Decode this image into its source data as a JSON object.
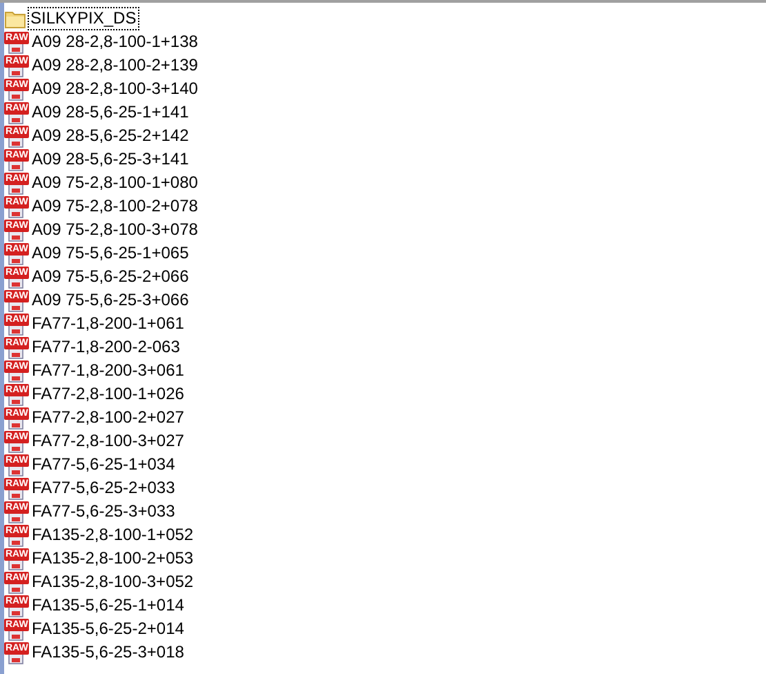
{
  "files": [
    {
      "kind": "folder",
      "name": "SILKYPIX_DS",
      "selected": true
    },
    {
      "kind": "raw",
      "badge": "RAW",
      "name": "A09 28-2,8-100-1+138",
      "selected": false
    },
    {
      "kind": "raw",
      "badge": "RAW",
      "name": "A09 28-2,8-100-2+139",
      "selected": false
    },
    {
      "kind": "raw",
      "badge": "RAW",
      "name": "A09 28-2,8-100-3+140",
      "selected": false
    },
    {
      "kind": "raw",
      "badge": "RAW",
      "name": "A09 28-5,6-25-1+141",
      "selected": false
    },
    {
      "kind": "raw",
      "badge": "RAW",
      "name": "A09 28-5,6-25-2+142",
      "selected": false
    },
    {
      "kind": "raw",
      "badge": "RAW",
      "name": "A09 28-5,6-25-3+141",
      "selected": false
    },
    {
      "kind": "raw",
      "badge": "RAW",
      "name": "A09 75-2,8-100-1+080",
      "selected": false
    },
    {
      "kind": "raw",
      "badge": "RAW",
      "name": "A09 75-2,8-100-2+078",
      "selected": false
    },
    {
      "kind": "raw",
      "badge": "RAW",
      "name": "A09 75-2,8-100-3+078",
      "selected": false
    },
    {
      "kind": "raw",
      "badge": "RAW",
      "name": "A09 75-5,6-25-1+065",
      "selected": false
    },
    {
      "kind": "raw",
      "badge": "RAW",
      "name": "A09 75-5,6-25-2+066",
      "selected": false
    },
    {
      "kind": "raw",
      "badge": "RAW",
      "name": "A09 75-5,6-25-3+066",
      "selected": false
    },
    {
      "kind": "raw",
      "badge": "RAW",
      "name": "FA77-1,8-200-1+061",
      "selected": false
    },
    {
      "kind": "raw",
      "badge": "RAW",
      "name": "FA77-1,8-200-2-063",
      "selected": false
    },
    {
      "kind": "raw",
      "badge": "RAW",
      "name": "FA77-1,8-200-3+061",
      "selected": false
    },
    {
      "kind": "raw",
      "badge": "RAW",
      "name": "FA77-2,8-100-1+026",
      "selected": false
    },
    {
      "kind": "raw",
      "badge": "RAW",
      "name": "FA77-2,8-100-2+027",
      "selected": false
    },
    {
      "kind": "raw",
      "badge": "RAW",
      "name": "FA77-2,8-100-3+027",
      "selected": false
    },
    {
      "kind": "raw",
      "badge": "RAW",
      "name": "FA77-5,6-25-1+034",
      "selected": false
    },
    {
      "kind": "raw",
      "badge": "RAW",
      "name": "FA77-5,6-25-2+033",
      "selected": false
    },
    {
      "kind": "raw",
      "badge": "RAW",
      "name": "FA77-5,6-25-3+033",
      "selected": false
    },
    {
      "kind": "raw",
      "badge": "RAW",
      "name": "FA135-2,8-100-1+052",
      "selected": false
    },
    {
      "kind": "raw",
      "badge": "RAW",
      "name": "FA135-2,8-100-2+053",
      "selected": false
    },
    {
      "kind": "raw",
      "badge": "RAW",
      "name": "FA135-2,8-100-3+052",
      "selected": false
    },
    {
      "kind": "raw",
      "badge": "RAW",
      "name": "FA135-5,6-25-1+014",
      "selected": false
    },
    {
      "kind": "raw",
      "badge": "RAW",
      "name": "FA135-5,6-25-2+014",
      "selected": false
    },
    {
      "kind": "raw",
      "badge": "RAW",
      "name": "FA135-5,6-25-3+018",
      "selected": false
    }
  ]
}
